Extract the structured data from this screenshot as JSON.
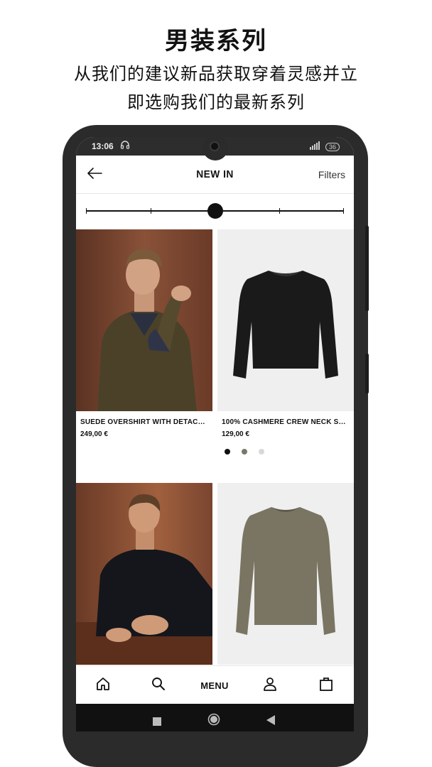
{
  "promo": {
    "title": "男装系列",
    "line1": "从我们的建议新品获取穿着灵感并立",
    "line2": "即选购我们的最新系列"
  },
  "status_bar": {
    "time": "13:06",
    "battery": "36"
  },
  "header": {
    "title": "NEW IN",
    "filters_label": "Filters"
  },
  "grid_slider": {
    "position": 0.5
  },
  "products": [
    {
      "name": "SUEDE OVERSHIRT WITH DETACHA...",
      "price": "249,00 €",
      "image": "model-suede-overshirt"
    },
    {
      "name": "100% CASHMERE CREW NECK SW...",
      "price": "129,00 €",
      "image": "black-cashmere-sweater",
      "swatches": [
        "#111111",
        "#7a7868",
        "#d8d8d8"
      ]
    },
    {
      "name": "",
      "price": "",
      "image": "model-black-sweater"
    },
    {
      "name": "",
      "price": "",
      "image": "khaki-sweater"
    }
  ],
  "bottom_nav": {
    "home_icon": "home-icon",
    "search_icon": "search-icon",
    "menu_label": "MENU",
    "account_icon": "user-icon",
    "bag_icon": "shopping-bag-icon"
  },
  "colors": {
    "phone_body": "#2b2b2b",
    "status_bar": "#2d2d2d",
    "accent": "#111111"
  }
}
